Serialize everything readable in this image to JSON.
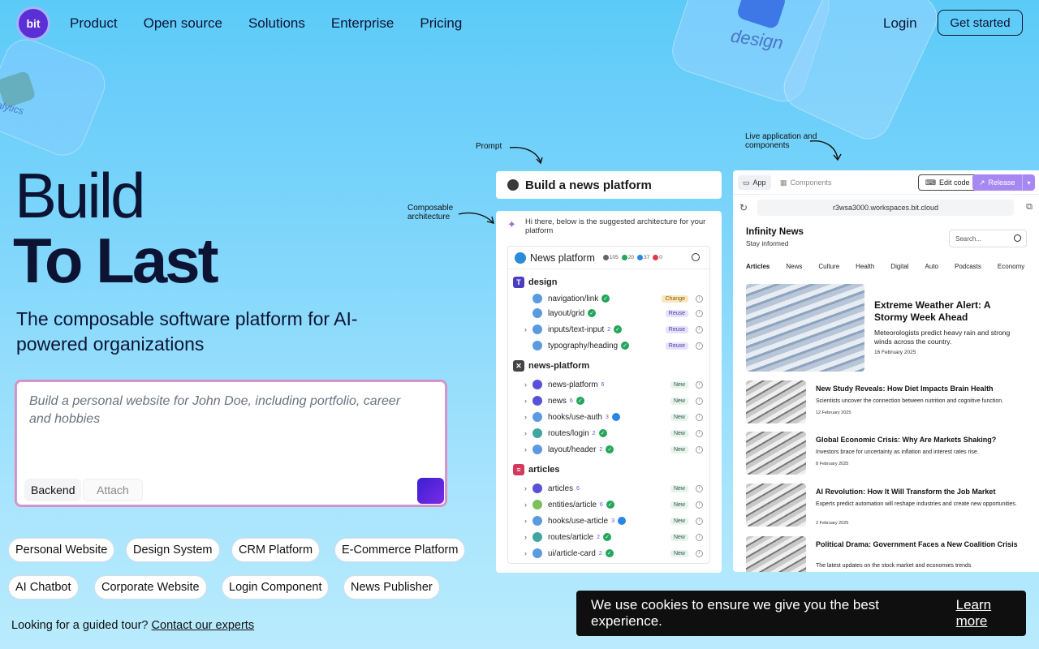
{
  "brand": {
    "logo_text": "bit"
  },
  "nav": {
    "items": [
      "Product",
      "Open source",
      "Solutions",
      "Enterprise",
      "Pricing"
    ],
    "login": "Login",
    "get_started": "Get started"
  },
  "decor": {
    "design_label": "design",
    "analytics_label": "alytics"
  },
  "hero": {
    "title_line1": "Build",
    "title_line2": "To Last",
    "subtitle": "The composable software platform for AI-powered organizations"
  },
  "prompt_input": {
    "placeholder": "Build a personal website for John Doe, including portfolio, career and hobbies",
    "backend_label": "Backend",
    "attach_label": "Attach"
  },
  "suggestions": [
    "Personal Website",
    "Design System",
    "CRM Platform",
    "E-Commerce Platform",
    "AI Chatbot",
    "Corporate Website",
    "Login Component",
    "News Publisher"
  ],
  "tour": {
    "text": "Looking for a guided tour?",
    "link": "Contact our experts"
  },
  "annotations": {
    "prompt": "Prompt",
    "composable": "Composable architecture",
    "live": "Live application and components"
  },
  "architecture": {
    "prompt_title": "Build a news platform",
    "intro": "Hi there, below is the suggested architecture for your platform",
    "platform_name": "News platform",
    "stats": {
      "components": "105",
      "ok": "20",
      "sync": "37",
      "errors": "0"
    },
    "scopes": [
      {
        "name": "design",
        "rows": [
          {
            "name": "navigation/link",
            "deps": "",
            "badge": "Change",
            "status": "ok"
          },
          {
            "name": "layout/grid",
            "deps": "",
            "badge": "Reuse",
            "status": "ok"
          },
          {
            "name": "inputs/text-input",
            "deps": "2",
            "badge": "Reuse",
            "status": "ok"
          },
          {
            "name": "typography/heading",
            "deps": "",
            "badge": "Reuse",
            "status": "ok"
          }
        ]
      },
      {
        "name": "news-platform",
        "rows": [
          {
            "name": "news-platform",
            "deps": "6",
            "badge": "New",
            "status": ""
          },
          {
            "name": "news",
            "deps": "6",
            "badge": "New",
            "status": "ok"
          },
          {
            "name": "hooks/use-auth",
            "deps": "3",
            "badge": "New",
            "status": "sync"
          },
          {
            "name": "routes/login",
            "deps": "2",
            "badge": "New",
            "status": "ok"
          },
          {
            "name": "layout/header",
            "deps": "2",
            "badge": "New",
            "status": "ok"
          }
        ]
      },
      {
        "name": "articles",
        "rows": [
          {
            "name": "articles",
            "deps": "6",
            "badge": "New",
            "status": ""
          },
          {
            "name": "entities/article",
            "deps": "6",
            "badge": "New",
            "status": "ok"
          },
          {
            "name": "hooks/use-article",
            "deps": "3",
            "badge": "New",
            "status": "sync"
          },
          {
            "name": "routes/article",
            "deps": "2",
            "badge": "New",
            "status": "ok"
          },
          {
            "name": "ui/article-card",
            "deps": "2",
            "badge": "New",
            "status": "ok"
          }
        ]
      }
    ]
  },
  "live_app": {
    "tab_app": "App",
    "tab_components": "Components",
    "edit_code": "Edit code",
    "release": "Release",
    "url": "r3wsa3000.workspaces.bit.cloud",
    "site_title": "Infinity News",
    "site_tagline": "Stay informed",
    "search_placeholder": "Search...",
    "categories": [
      "Articles",
      "News",
      "Culture",
      "Health",
      "Digital",
      "Auto",
      "Podcasts",
      "Economy"
    ],
    "featured": {
      "title": "Extreme Weather Alert: A Stormy Week Ahead",
      "desc": "Meteorologists predict heavy rain and strong winds across the country.",
      "date": "16 February 2025"
    },
    "articles": [
      {
        "title": "New Study Reveals: How Diet Impacts Brain Health",
        "desc": "Scientists uncover the connection between nutrition and cognitive function.",
        "date": "12 February 2025"
      },
      {
        "title": "Global Economic Crisis: Why Are Markets Shaking?",
        "desc": "Investors brace for uncertainty as inflation and interest rates rise.",
        "date": "8 February 2025"
      },
      {
        "title": "AI Revolution: How It Will Transform the Job Market",
        "desc": "Experts predict automation will reshape industries and create new opportunities.",
        "date": "2 February 2025"
      },
      {
        "title": "Political Drama: Government Faces a New Coalition Crisis",
        "desc": "The latest updates on the stock market and economies trends",
        "date": ""
      }
    ]
  },
  "cookie": {
    "text": "We use cookies to ensure we give you the best experience.",
    "link": "Learn more"
  }
}
